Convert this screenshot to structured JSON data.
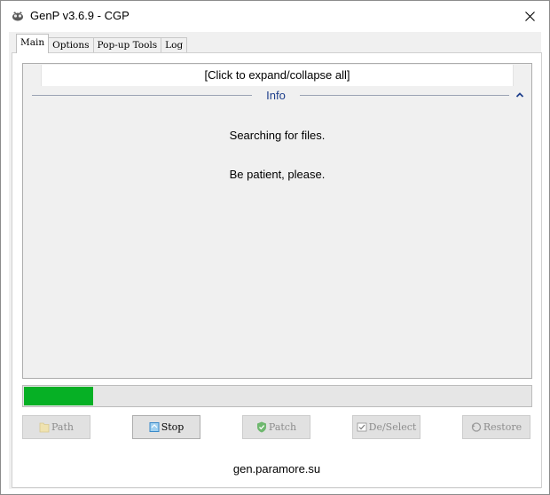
{
  "window": {
    "title": "GenP v3.6.9 - CGP"
  },
  "tabs": [
    {
      "label": "Main",
      "active": true
    },
    {
      "label": "Options",
      "active": false
    },
    {
      "label": "Pop-up Tools",
      "active": false
    },
    {
      "label": "Log",
      "active": false
    }
  ],
  "panel": {
    "expand_label": "[Click to expand/collapse all]",
    "section_label": "Info",
    "messages": [
      "Searching for files.",
      "Be patient, please."
    ]
  },
  "progress": {
    "fraction": 0.136,
    "color": "#06b025"
  },
  "buttons": [
    {
      "label": "Path",
      "enabled": false,
      "icon": "folder-icon"
    },
    {
      "label": "Stop",
      "enabled": true,
      "icon": "stop-icon"
    },
    {
      "label": "Patch",
      "enabled": false,
      "icon": "shield-check-icon"
    },
    {
      "label": "De/Select",
      "enabled": false,
      "icon": "checkbox-icon"
    },
    {
      "label": "Restore",
      "enabled": false,
      "icon": "restore-icon"
    }
  ],
  "footer": {
    "text": "gen.paramore.su"
  }
}
